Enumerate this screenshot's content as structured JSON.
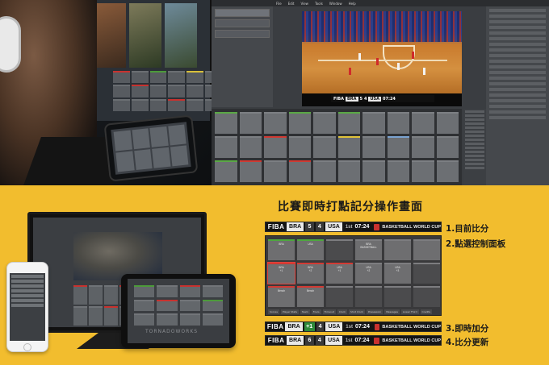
{
  "title": "比賽即時打點記分操作畫面",
  "top_app": {
    "menu": [
      "File",
      "Edit",
      "View",
      "Tools",
      "Window",
      "Help"
    ]
  },
  "scoreboards": {
    "current": {
      "logo": "FIBA",
      "team1": "BRA",
      "score1": "5",
      "score2": "4",
      "team2": "USA",
      "quarter": "1st",
      "time": "07:24",
      "league": "BASKETBALL WORLD CUP"
    },
    "adding": {
      "logo": "FIBA",
      "team1": "BRA",
      "score1": "+1",
      "score2": "4",
      "team2": "USA",
      "quarter": "1st",
      "time": "07:24",
      "league": "BASKETBALL WORLD CUP"
    },
    "updated": {
      "logo": "FIBA",
      "team1": "BRA",
      "score1": "6",
      "score2": "4",
      "team2": "USA",
      "quarter": "1st",
      "time": "07:24",
      "league": "BASKETBALL WORLD CUP"
    }
  },
  "panel": {
    "tiles": [
      "BRA",
      "USA",
      "",
      "BRA\nBASKETBALL",
      "",
      "",
      "BRA\n+1",
      "BRA\n+2",
      "USA\n+1",
      "USA\n+2",
      "USA\n+3",
      "",
      "Bench",
      "Bench",
      "",
      "",
      "",
      ""
    ],
    "tabs": [
      "Scores",
      "Player Stats",
      "Team",
      "Fouls",
      "Timeout",
      "Clock",
      "Shot Clock",
      "Possession",
      "Messages",
      "Lower Third",
      "Credits"
    ]
  },
  "labels": {
    "l1": "1.目前比分",
    "l2": "2.點選控制面板",
    "l3": "3.即時加分",
    "l4": "4.比分更新"
  },
  "device_logo": "TORNADOWORKS",
  "colors": {
    "background": "#f2bd2e",
    "accent_red": "#d23a33",
    "accent_green": "#4ea83f"
  }
}
